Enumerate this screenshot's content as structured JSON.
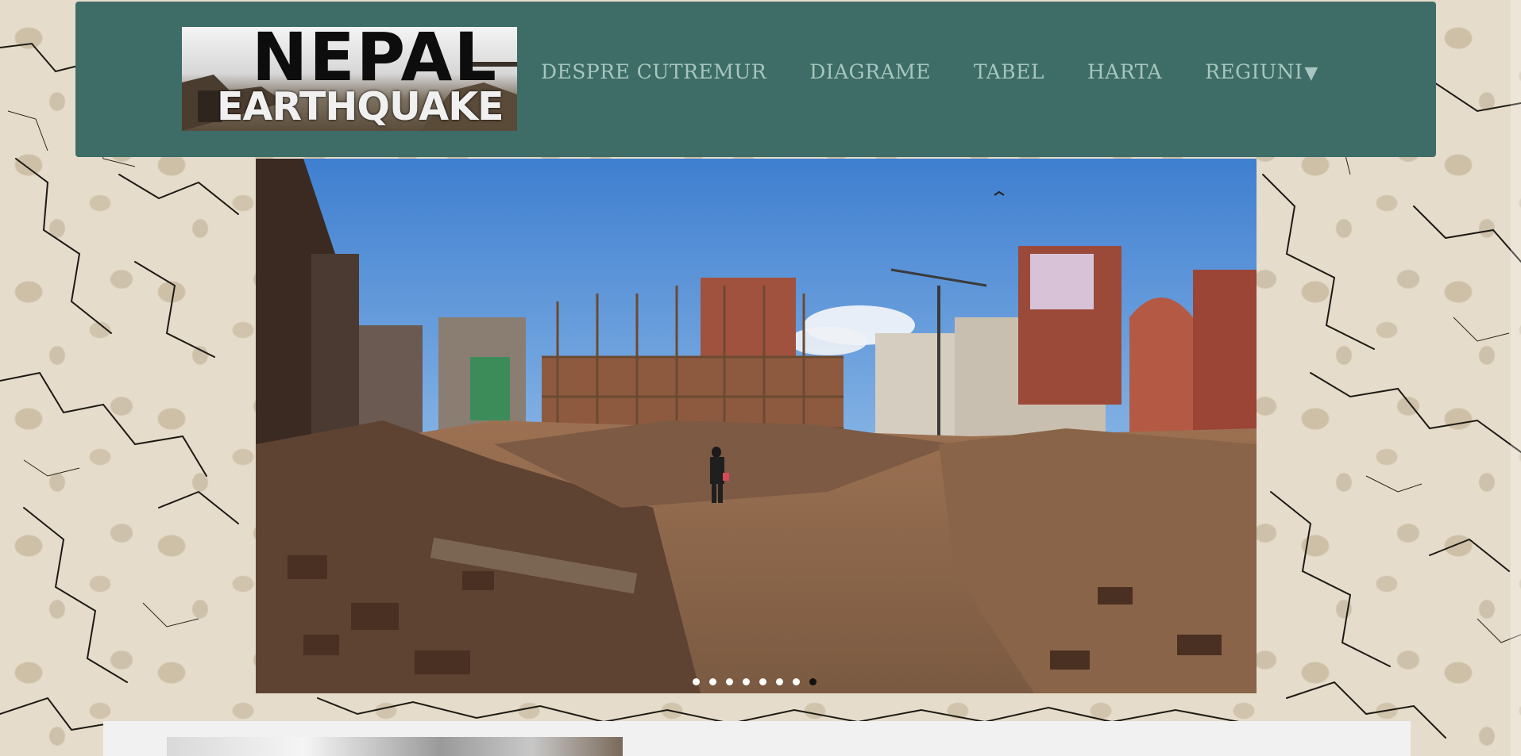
{
  "logo": {
    "line1": "NEPAL",
    "line2": "EARTHQUAKE"
  },
  "nav": {
    "items": [
      {
        "label": "DESPRE CUTREMUR"
      },
      {
        "label": "DIAGRAME"
      },
      {
        "label": "TABEL"
      },
      {
        "label": "HARTA"
      },
      {
        "label": "REGIUNI",
        "arrow": "▼"
      }
    ]
  },
  "slider": {
    "slide_count": 8,
    "active_index": 7
  },
  "colors": {
    "nav_bg": "#3e6d67",
    "nav_text": "#a7c6bf",
    "page_bg": "#e6dccb",
    "lower_panel": "#f1f1f1"
  }
}
